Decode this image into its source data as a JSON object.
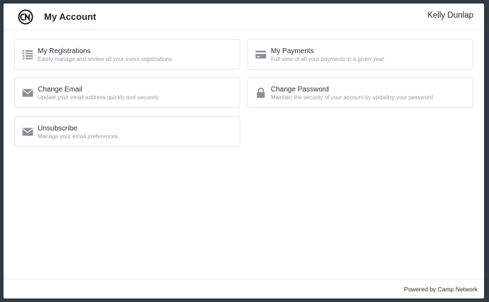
{
  "header": {
    "title": "My Account",
    "user_name": "Kelly Dunlap",
    "logo_icon": "camp-network-logo"
  },
  "cards": [
    {
      "icon": "list-icon",
      "title": "My Registrations",
      "description": "Easily manage and review all your event registrations."
    },
    {
      "icon": "credit-card-icon",
      "title": "My Payments",
      "description": "Full view of all your payments in a given year."
    },
    {
      "icon": "envelope-icon",
      "title": "Change Email",
      "description": "Update your email address quickly and securely."
    },
    {
      "icon": "lock-icon",
      "title": "Change Password",
      "description": "Maintain the security of your account by updating your password."
    },
    {
      "icon": "envelope-icon",
      "title": "Unsubscribe",
      "description": "Manage your email preferences."
    }
  ],
  "footer": {
    "text": "Powered by Camp Network"
  },
  "colors": {
    "background": "#2f3a42",
    "icon": "#8a9099",
    "text": "#1f2328",
    "muted": "#9aa0a6"
  }
}
